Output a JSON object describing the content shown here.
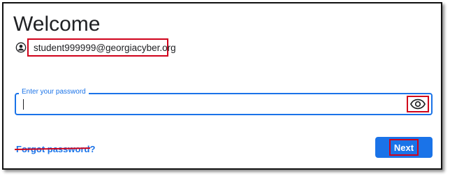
{
  "header": {
    "title": "Welcome"
  },
  "account": {
    "icon": "account-circle-icon",
    "email": "student999999@georgiacyber.org"
  },
  "password_field": {
    "label": "Enter your password",
    "value": "",
    "toggle_icon": "eye-icon"
  },
  "actions": {
    "forgot_label": "Forgot password?",
    "next_label": "Next"
  },
  "colors": {
    "accent": "#1a73e8",
    "annotation": "#d0021b",
    "text": "#202124"
  }
}
